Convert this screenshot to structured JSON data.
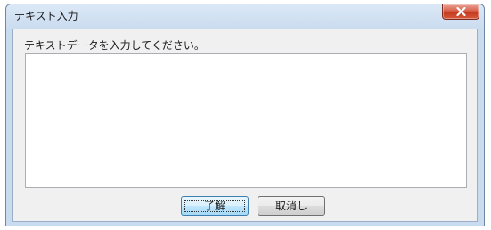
{
  "window": {
    "title": "テキスト入力",
    "close_icon": "close-x-icon"
  },
  "dialog": {
    "prompt": "テキストデータを入力してください。",
    "input_value": ""
  },
  "buttons": {
    "ok_label": "了解",
    "cancel_label": "取消し"
  },
  "colors": {
    "title_bar": "#c9dbef",
    "close_button": "#c4391e",
    "client_background": "#f0f0f0",
    "ok_button_border": "#3c7fb1"
  }
}
